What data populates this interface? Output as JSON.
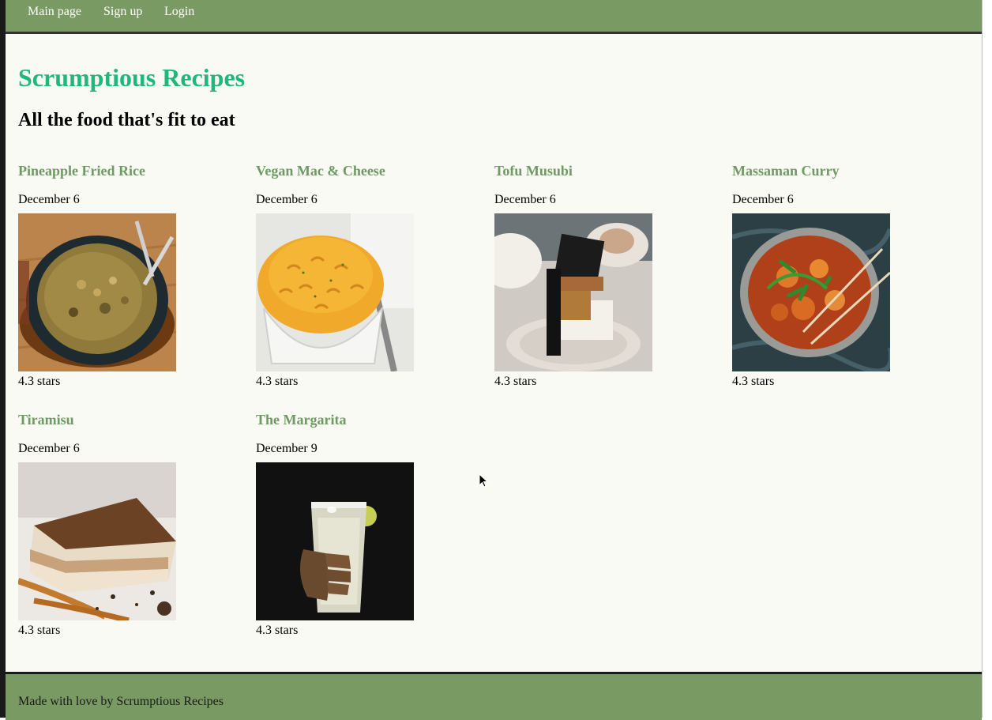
{
  "nav": {
    "items": [
      {
        "label": "Main page"
      },
      {
        "label": "Sign up"
      },
      {
        "label": "Login"
      }
    ]
  },
  "header": {
    "title": "Scrumptious Recipes",
    "tagline": "All the food that's fit to eat"
  },
  "recipes": [
    {
      "title": "Pineapple Fried Rice",
      "date": "December 6",
      "rating": "4.3 stars"
    },
    {
      "title": "Vegan Mac & Cheese",
      "date": "December 6",
      "rating": "4.3 stars"
    },
    {
      "title": "Tofu Musubi",
      "date": "December 6",
      "rating": "4.3 stars"
    },
    {
      "title": "Massaman Curry",
      "date": "December 6",
      "rating": "4.3 stars"
    },
    {
      "title": "Tiramisu",
      "date": "December 6",
      "rating": "4.3 stars"
    },
    {
      "title": "The Margarita",
      "date": "December 9",
      "rating": "4.3 stars"
    }
  ],
  "footer": {
    "text": "Made with love by Scrumptious Recipes"
  },
  "colors": {
    "nav_bg": "#7a9a64",
    "title": "#20b87a",
    "recipe_link": "#6f9a64",
    "page_bg": "#f8faf3"
  }
}
